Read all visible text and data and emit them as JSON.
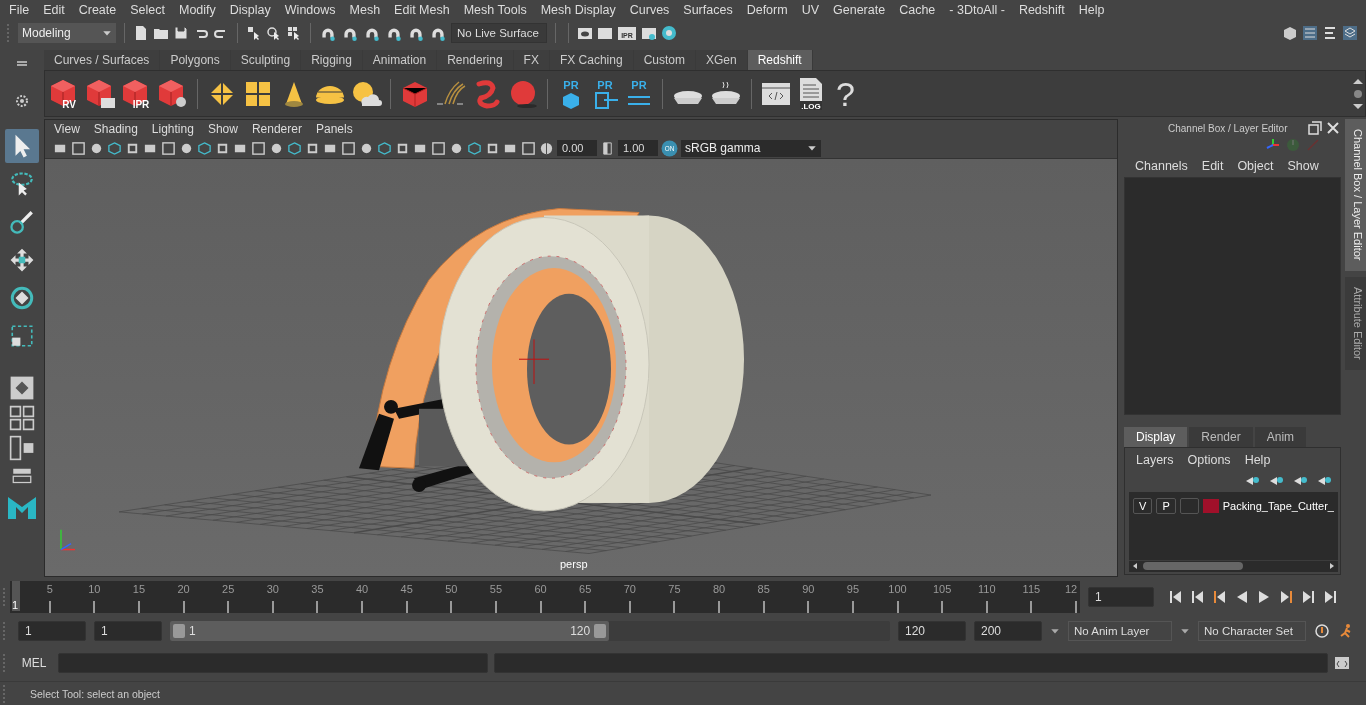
{
  "menu_bar": [
    "File",
    "Edit",
    "Create",
    "Select",
    "Modify",
    "Display",
    "Windows",
    "Mesh",
    "Edit Mesh",
    "Mesh Tools",
    "Mesh Display",
    "Curves",
    "Surfaces",
    "Deform",
    "UV",
    "Generate",
    "Cache",
    "- 3DtoAll -",
    "Redshift",
    "Help"
  ],
  "status_line": {
    "mode": "Modeling",
    "live_surface": "No Live Surface",
    "render_badge": "IPR"
  },
  "shelf_tabs": [
    {
      "label": "Curves / Surfaces",
      "selected": false
    },
    {
      "label": "Polygons",
      "selected": false
    },
    {
      "label": "Sculpting",
      "selected": false
    },
    {
      "label": "Rigging",
      "selected": false
    },
    {
      "label": "Animation",
      "selected": false
    },
    {
      "label": "Rendering",
      "selected": false
    },
    {
      "label": "FX",
      "selected": false
    },
    {
      "label": "FX Caching",
      "selected": false
    },
    {
      "label": "Custom",
      "selected": false
    },
    {
      "label": "XGen",
      "selected": false
    },
    {
      "label": "Redshift",
      "selected": true
    }
  ],
  "shelf": {
    "rv_badge": "RV",
    "ipr_badge": "IPR",
    "pr_badges": [
      "PR",
      "PR",
      "PR"
    ],
    "log_badge": ".LOG",
    "help_glyph": "?"
  },
  "tools": [
    {
      "kind": "select",
      "selected": true
    },
    {
      "kind": "lasso",
      "selected": false
    },
    {
      "kind": "paint",
      "selected": false
    },
    {
      "kind": "move",
      "selected": false
    },
    {
      "kind": "rotate",
      "selected": false
    },
    {
      "kind": "scale",
      "selected": false
    }
  ],
  "viewport": {
    "menus": [
      "View",
      "Shading",
      "Lighting",
      "Show",
      "Renderer",
      "Panels"
    ],
    "exposure": "0.00",
    "gamma": "1.00",
    "color_toggle": "ON",
    "color_space": "sRGB gamma",
    "camera": "persp"
  },
  "channel_box": {
    "title": "Channel Box / Layer Editor",
    "menus": [
      "Channels",
      "Edit",
      "Object",
      "Show"
    ],
    "layer_tabs": [
      {
        "label": "Display",
        "selected": true
      },
      {
        "label": "Render",
        "selected": false
      },
      {
        "label": "Anim",
        "selected": false
      }
    ],
    "layer_menus": [
      "Layers",
      "Options",
      "Help"
    ],
    "layers": [
      {
        "visible": "V",
        "playback": "P",
        "color": "#a0102a",
        "name": "Packing_Tape_Cutter_"
      }
    ]
  },
  "side_tabs": [
    {
      "label": "Channel Box / Layer Editor",
      "selected": true
    },
    {
      "label": "Attribute Editor",
      "selected": false
    }
  ],
  "timeline": {
    "level": 0,
    "start_label": "1",
    "ticks": [
      "5",
      "10",
      "15",
      "20",
      "25",
      "30",
      "35",
      "40",
      "45",
      "50",
      "55",
      "60",
      "65",
      "70",
      "75",
      "80",
      "85",
      "90",
      "95",
      "100",
      "105",
      "110",
      "115",
      "12"
    ],
    "current_frame": "1"
  },
  "range": {
    "level": 0.61,
    "start": "1",
    "playback_start": "1",
    "slider_start": "1",
    "slider_end": "120",
    "playback_end": "120",
    "end": "200",
    "anim_layer": "No Anim Layer",
    "character_set": "No Character Set"
  },
  "command_line": {
    "language": "MEL"
  },
  "help_line": "Select Tool: select an object"
}
